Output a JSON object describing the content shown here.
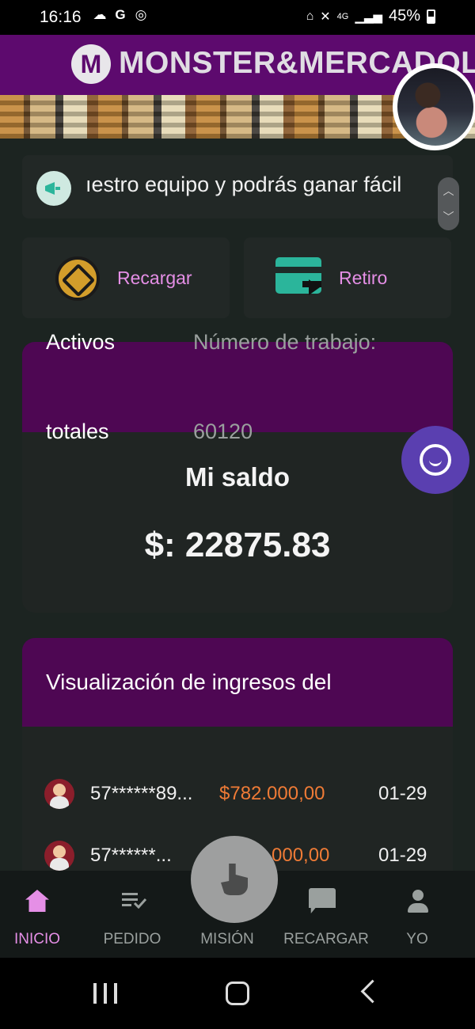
{
  "status_bar": {
    "time": "16:16",
    "battery": "45%",
    "network": "4G"
  },
  "header": {
    "logo_letter": "M",
    "brand": "MONSTER&MERCADOLIBRE",
    "brand_color": "#5d0a6e"
  },
  "marquee": {
    "text": "ıestro equipo y podrás ganar fácil"
  },
  "actions": {
    "recargar_label": "Recargar",
    "retiro_label": "Retiro"
  },
  "balance": {
    "activos_label": "Activos",
    "totales_label": "totales",
    "work_number_label": "Número de trabajo:",
    "work_number_value": "60120",
    "title": "Mi saldo",
    "amount": "$: 22875.83"
  },
  "income": {
    "title": "Visualización de ingresos del",
    "rows": [
      {
        "user": "57******89...",
        "amount": "$782.000,00",
        "date": "01-29"
      },
      {
        "user": "57******...",
        "amount": "000,00",
        "date": "01-29"
      }
    ]
  },
  "bottom_nav": {
    "items": [
      {
        "label": "INICIO",
        "icon": "home-icon",
        "active": true
      },
      {
        "label": "PEDIDO",
        "icon": "order-list-icon",
        "active": false
      },
      {
        "label": "MISIÓN",
        "icon": "tap-hand-icon",
        "active": false
      },
      {
        "label": "RECARGAR",
        "icon": "chat-icon",
        "active": false
      },
      {
        "label": "YO",
        "icon": "person-icon",
        "active": false
      }
    ],
    "accent_color": "#e58fe6"
  },
  "colors": {
    "amount_orange": "#ef7b36",
    "panel_purple": "#4e0753",
    "support_button": "#5a3fb0"
  }
}
